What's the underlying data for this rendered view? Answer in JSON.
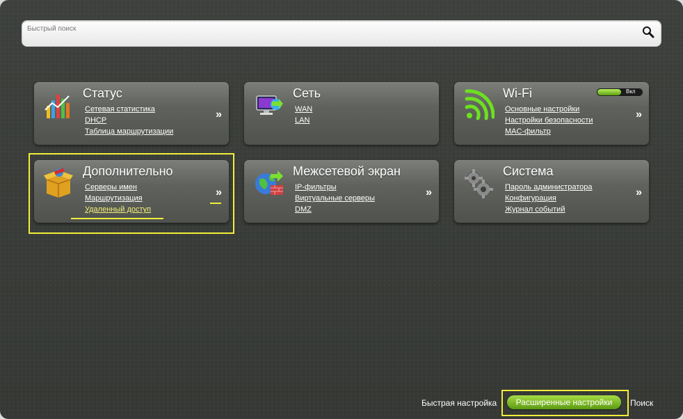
{
  "search": {
    "placeholder": "Быстрый поиск",
    "icon": "search-icon"
  },
  "tiles": {
    "status": {
      "title": "Статус",
      "links": [
        "Сетевая статистика",
        "DHCP",
        "Таблица маршрутизации"
      ],
      "arrow": "»"
    },
    "network": {
      "title": "Сеть",
      "links": [
        "WAN",
        "LAN"
      ],
      "arrow": "»"
    },
    "wifi": {
      "title": "Wi-Fi",
      "toggle_label": "Вкл",
      "links": [
        "Основные настройки",
        "Настройки безопасности",
        "MAC-фильтр"
      ],
      "arrow": "»"
    },
    "advanced": {
      "title": "Дополнительно",
      "links": [
        "Серверы имен",
        "Маршрутизация",
        "Удаленный доступ"
      ],
      "arrow": "»"
    },
    "firewall": {
      "title": "Межсетевой экран",
      "links": [
        "IP-фильтры",
        "Виртуальные серверы",
        "DMZ"
      ],
      "arrow": "»"
    },
    "system": {
      "title": "Система",
      "links": [
        "Пароль администратора",
        "Конфигурация",
        "Журнал событий"
      ],
      "arrow": "»"
    }
  },
  "bottom_nav": {
    "quick_setup": "Быстрая настройка",
    "advanced_settings": "Расширенные настройки",
    "search": "Поиск"
  },
  "colors": {
    "highlight": "#f2ee3a",
    "active_button": "#7fbf2a",
    "background": "#3a3d39"
  }
}
